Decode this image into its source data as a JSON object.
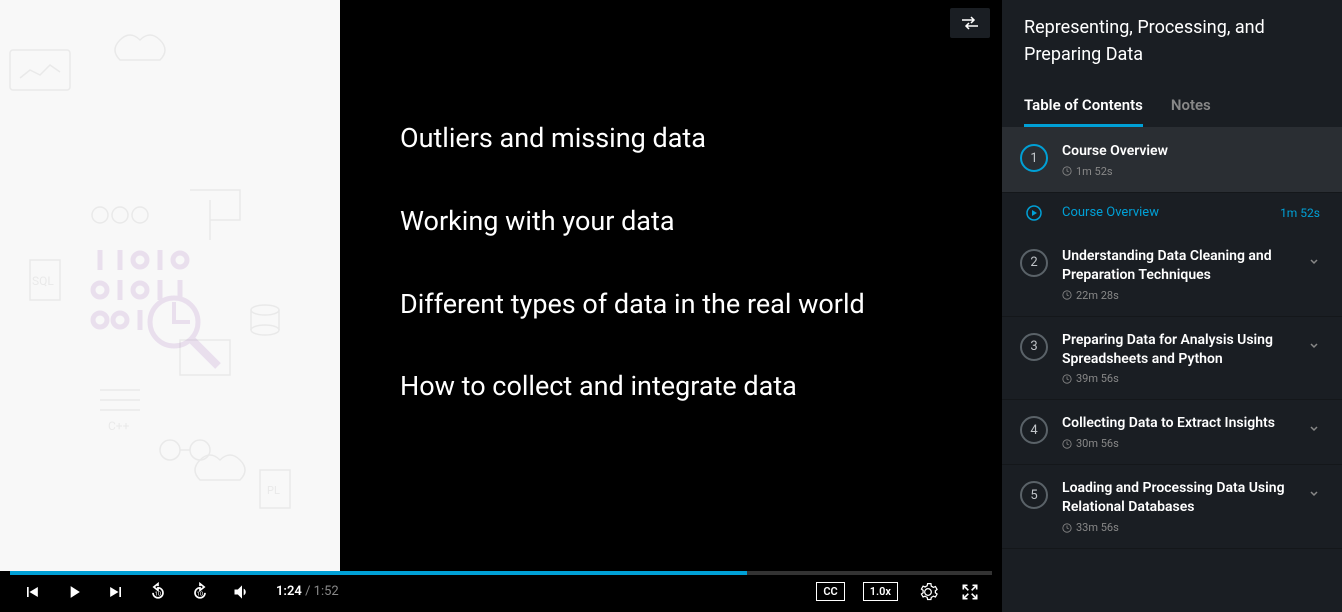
{
  "course_title": "Representing, Processing, and Preparing Data",
  "tabs": {
    "toc": "Table of Contents",
    "notes": "Notes"
  },
  "slide": {
    "lines": [
      "Outliers and missing data",
      "Working with your data",
      "Different types of data in the real world",
      "How to collect and integrate data"
    ]
  },
  "player": {
    "current_time": "1:24",
    "total_time": "1:52",
    "speed": "1.0x",
    "cc_label": "CC",
    "progress_pct": 75
  },
  "modules": [
    {
      "num": "1",
      "title": "Course Overview",
      "duration": "1m 52s",
      "active": true,
      "lessons": [
        {
          "name": "Course Overview",
          "duration": "1m 52s",
          "playing": true
        }
      ]
    },
    {
      "num": "2",
      "title": "Understanding Data Cleaning and Preparation Techniques",
      "duration": "22m 28s"
    },
    {
      "num": "3",
      "title": "Preparing Data for Analysis Using Spreadsheets and Python",
      "duration": "39m 56s"
    },
    {
      "num": "4",
      "title": "Collecting Data to Extract Insights",
      "duration": "30m 56s"
    },
    {
      "num": "5",
      "title": "Loading and Processing Data Using Relational Databases",
      "duration": "33m 56s"
    }
  ]
}
